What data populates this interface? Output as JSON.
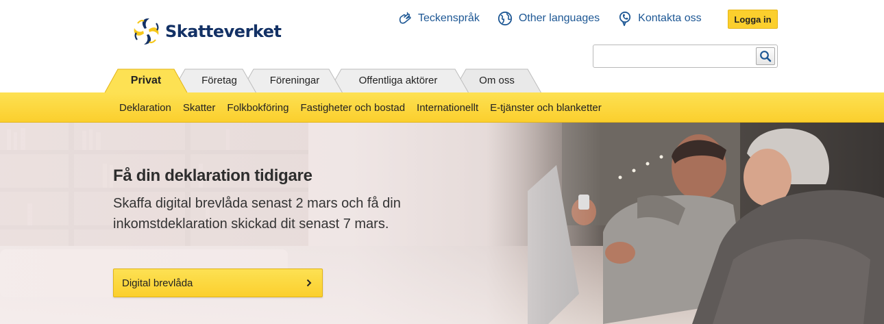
{
  "brand": {
    "name": "Skatteverket",
    "color": "#133165",
    "accent": "#fbcf2d"
  },
  "toplinks": [
    {
      "label": "Teckenspråk",
      "icon": "sign-language-icon"
    },
    {
      "label": "Other languages",
      "icon": "globe-icon"
    },
    {
      "label": "Kontakta oss",
      "icon": "contact-icon"
    }
  ],
  "login": {
    "label": "Logga in"
  },
  "search": {
    "placeholder": "",
    "value": "",
    "icon": "search-icon"
  },
  "tabs": [
    {
      "label": "Privat",
      "active": true
    },
    {
      "label": "Företag",
      "active": false
    },
    {
      "label": "Föreningar",
      "active": false
    },
    {
      "label": "Offentliga aktörer",
      "active": false
    },
    {
      "label": "Om oss",
      "active": false
    }
  ],
  "subnav": [
    "Deklaration",
    "Skatter",
    "Folkbokföring",
    "Fastigheter och bostad",
    "Internationellt",
    "E-tjänster och blanketter"
  ],
  "hero": {
    "title": "Få din deklaration tidigare",
    "text": "Skaffa digital brevlåda senast 2 mars och få din inkomstdeklaration skickad dit senast 7 mars.",
    "button_label": "Digital brevlåda",
    "button_icon": "chevron-right-icon"
  }
}
